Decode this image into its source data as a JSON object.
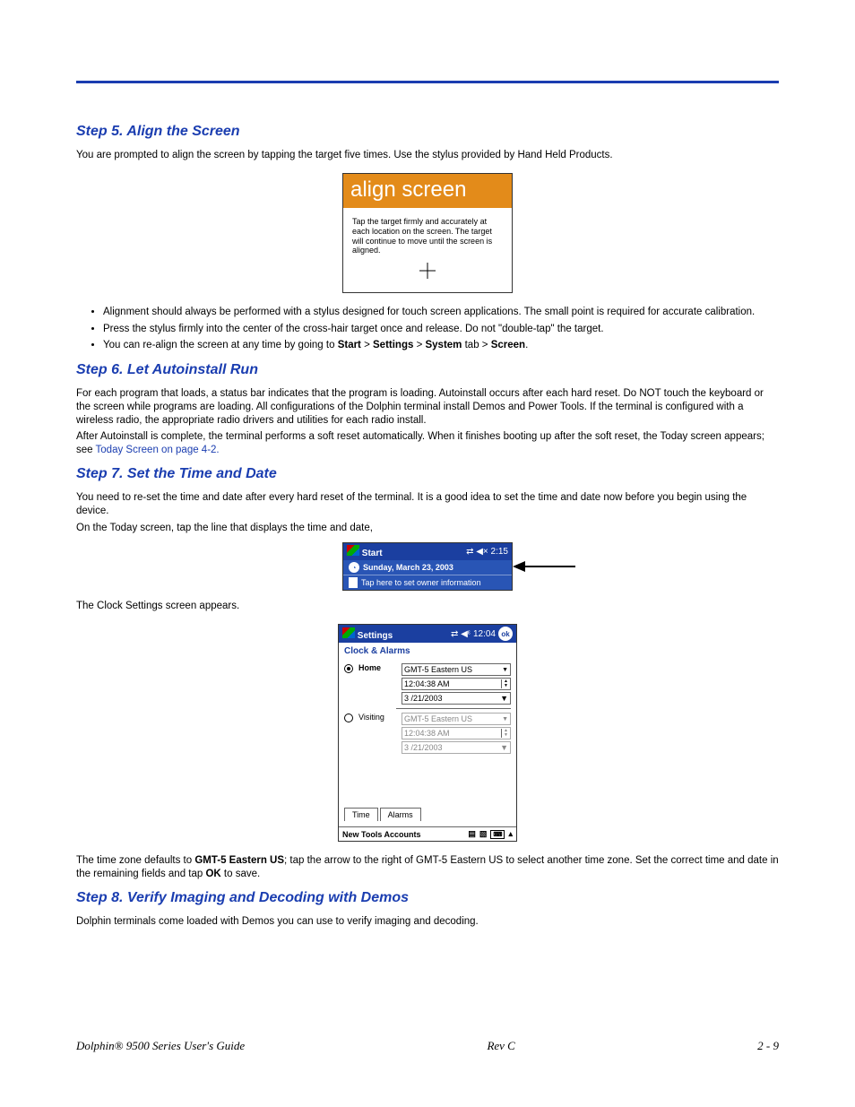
{
  "step5": {
    "heading": "Step 5.  Align the Screen",
    "intro": "You are prompted to align the screen by tapping the target five times. Use the stylus provided by Hand Held Products.",
    "align": {
      "title": "align screen",
      "body": "Tap the target firmly and accurately at each location on the screen. The target will continue to move until the screen is aligned."
    },
    "bullets": [
      "Alignment should always be performed with a stylus designed for touch screen applications. The small point is required for accurate calibration.",
      "Press the stylus firmly into the center of the cross-hair target once and release. Do not \"double-tap\" the target."
    ],
    "bullet3_pre": "You can re-align the screen at any time by going to ",
    "nav": {
      "start": "Start",
      "settings": "Settings",
      "system": "System",
      "screen": "Screen"
    },
    "tab_word": " tab > "
  },
  "step6": {
    "heading": "Step 6.  Let Autoinstall Run",
    "p1": "For each program that loads, a status bar indicates that the program is loading. Autoinstall occurs after each hard reset. Do NOT touch the keyboard or the screen while programs are loading. All configurations of the Dolphin terminal install Demos and Power Tools. If the terminal is configured with a wireless radio, the appropriate radio drivers and utilities for each radio install.",
    "p2_pre": "After Autoinstall is complete, the terminal performs a soft reset automatically. When it finishes booting up after the soft reset, the Today screen appears; see ",
    "link": "Today Screen on page 4-2.",
    "p2_post": ""
  },
  "step7": {
    "heading": "Step 7.  Set the Time and Date",
    "p1": "You need to re-set the time and date after every hard reset of the terminal. It is a good idea to set the time and date now before you begin using the device.",
    "p2": "On the Today screen, tap the line that displays the time and date,",
    "today": {
      "title": "Start",
      "time": "2:15",
      "date": "Sunday, March 23, 2003",
      "owner": "Tap here to set owner information"
    },
    "p3": "The Clock Settings screen appears.",
    "settings": {
      "title": "Settings",
      "time": "12:04",
      "ok": "ok",
      "subtitle": "Clock & Alarms",
      "home": {
        "label": "Home",
        "tz": "GMT-5 Eastern US",
        "clock": "12:04:38 AM",
        "date": "3 /21/2003"
      },
      "visiting": {
        "label": "Visiting",
        "tz": "GMT-5 Eastern US",
        "clock": "12:04:38 AM",
        "date": "3 /21/2003"
      },
      "tabs": {
        "time": "Time",
        "alarms": "Alarms"
      },
      "menu": "New Tools Accounts"
    },
    "p4_pre": "The time zone defaults to ",
    "p4_bold": "GMT-5 Eastern US",
    "p4_mid": "; tap the arrow to the right of GMT-5 Eastern US to select another time zone. Set the correct time and date in the remaining fields and tap ",
    "p4_bold2": "OK",
    "p4_post": " to save."
  },
  "step8": {
    "heading": "Step 8.  Verify Imaging and Decoding with Demos",
    "p1": "Dolphin terminals come loaded with Demos you can use to verify imaging and decoding."
  },
  "footer": {
    "left": "Dolphin® 9500 Series User's Guide",
    "center": "Rev C",
    "right": "2 - 9"
  }
}
